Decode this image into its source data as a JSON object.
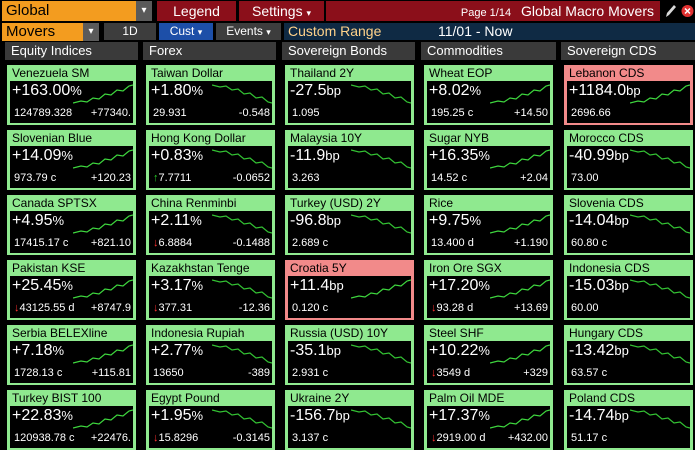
{
  "toolbar": {
    "view_select": "Global",
    "view_arrow": "▾",
    "legend_label": "Legend",
    "settings_label": "Settings",
    "settings_arrow": "▾",
    "page_label": "Page 1/14",
    "title": "Global Macro Movers"
  },
  "subbar": {
    "mode_select": "Movers",
    "period": "1D",
    "cust_label": "Cust",
    "cust_arrow": "▾",
    "events_label": "Events",
    "events_arrow": "▾",
    "range_label": "Custom Range",
    "range_value": "11/01 - Now"
  },
  "columns": [
    "Equity Indices",
    "Forex",
    "Sovereign Bonds",
    "Commodities",
    "Sovereign CDS"
  ],
  "colors": {
    "tile_up": "#8fe98f",
    "tile_down": "#f28a8a",
    "accent": "#f39c1f",
    "red_button": "#8b0f1a"
  },
  "tiles": [
    [
      {
        "name": "Venezuela SM",
        "pct": "+163.00",
        "unit": "%",
        "price": "124789.328",
        "chg": "+77340.",
        "arrow": "",
        "spark": "up"
      },
      {
        "name": "Slovenian Blue",
        "pct": "+14.09",
        "unit": "%",
        "price": "973.79 c",
        "chg": "+120.23",
        "arrow": "",
        "spark": "up"
      },
      {
        "name": "Canada SPTSX",
        "pct": "+4.95",
        "unit": "%",
        "price": "17415.17 c",
        "chg": "+821.10",
        "arrow": "",
        "spark": "up"
      },
      {
        "name": "Pakistan KSE",
        "pct": "+25.45",
        "unit": "%",
        "price": "43125.55 d",
        "chg": "+8747.9",
        "arrow": "down",
        "spark": "up"
      },
      {
        "name": "Serbia BELEXline",
        "pct": "+7.18",
        "unit": "%",
        "price": "1728.13 c",
        "chg": "+115.81",
        "arrow": "",
        "spark": "up"
      },
      {
        "name": "Turkey BIST 100",
        "pct": "+22.83",
        "unit": "%",
        "price": "120938.78 c",
        "chg": "+22476.",
        "arrow": "",
        "spark": "up"
      }
    ],
    [
      {
        "name": "Taiwan Dollar",
        "pct": "+1.80",
        "unit": "%",
        "price": "29.931",
        "chg": "-0.548",
        "arrow": "",
        "spark": "down"
      },
      {
        "name": "Hong Kong Dollar",
        "pct": "+0.83",
        "unit": "%",
        "price": "7.7711",
        "chg": "-0.0652",
        "arrow": "up",
        "spark": "down"
      },
      {
        "name": "China Renminbi",
        "pct": "+2.11",
        "unit": "%",
        "price": "6.8884",
        "chg": "-0.1488",
        "arrow": "down",
        "spark": "down"
      },
      {
        "name": "Kazakhstan Tenge",
        "pct": "+3.17",
        "unit": "%",
        "price": "377.31",
        "chg": "-12.36",
        "arrow": "down",
        "spark": "down"
      },
      {
        "name": "Indonesia Rupiah",
        "pct": "+2.77",
        "unit": "%",
        "price": "13650",
        "chg": "-389",
        "arrow": "",
        "spark": "down"
      },
      {
        "name": "Egypt Pound",
        "pct": "+1.95",
        "unit": "%",
        "price": "15.8296",
        "chg": "-0.3145",
        "arrow": "down",
        "spark": "down"
      }
    ],
    [
      {
        "name": "Thailand 2Y",
        "pct": "-27.5",
        "unit": "bp",
        "price": "1.095",
        "chg": "",
        "arrow": "",
        "spark": "down"
      },
      {
        "name": "Malaysia 10Y",
        "pct": "-11.9",
        "unit": "bp",
        "price": "3.263",
        "chg": "",
        "arrow": "",
        "spark": "down"
      },
      {
        "name": "Turkey (USD) 2Y",
        "pct": "-96.8",
        "unit": "bp",
        "price": "2.689 c",
        "chg": "",
        "arrow": "",
        "spark": "down"
      },
      {
        "name": "Croatia 5Y",
        "pct": "+11.4",
        "unit": "bp",
        "price": "0.120 c",
        "chg": "",
        "arrow": "",
        "spark": "up",
        "red": true
      },
      {
        "name": "Russia (USD) 10Y",
        "pct": "-35.1",
        "unit": "bp",
        "price": "2.931 c",
        "chg": "",
        "arrow": "",
        "spark": "down"
      },
      {
        "name": "Ukraine 2Y",
        "pct": "-156.7",
        "unit": "bp",
        "price": "3.137 c",
        "chg": "",
        "arrow": "",
        "spark": "down"
      }
    ],
    [
      {
        "name": "Wheat EOP",
        "pct": "+8.02",
        "unit": "%",
        "price": "195.25 c",
        "chg": "+14.50",
        "arrow": "",
        "spark": "up"
      },
      {
        "name": "Sugar NYB",
        "pct": "+16.35",
        "unit": "%",
        "price": "14.52 c",
        "chg": "+2.04",
        "arrow": "",
        "spark": "up"
      },
      {
        "name": "Rice",
        "pct": "+9.75",
        "unit": "%",
        "price": "13.400 d",
        "chg": "+1.190",
        "arrow": "",
        "spark": "up"
      },
      {
        "name": "Iron Ore SGX",
        "pct": "+17.20",
        "unit": "%",
        "price": "93.28 d",
        "chg": "+13.69",
        "arrow": "down",
        "spark": "up"
      },
      {
        "name": "Steel SHF",
        "pct": "+10.22",
        "unit": "%",
        "price": "3549 d",
        "chg": "+329",
        "arrow": "down",
        "spark": "up"
      },
      {
        "name": "Palm Oil MDE",
        "pct": "+17.37",
        "unit": "%",
        "price": "2919.00 d",
        "chg": "+432.00",
        "arrow": "down",
        "spark": "up"
      }
    ],
    [
      {
        "name": "Lebanon CDS",
        "pct": "+1184.0",
        "unit": "bp",
        "price": "2696.66",
        "chg": "",
        "arrow": "",
        "spark": "up",
        "red": true
      },
      {
        "name": "Morocco CDS",
        "pct": "-40.99",
        "unit": "bp",
        "price": "73.00",
        "chg": "",
        "arrow": "",
        "spark": "down"
      },
      {
        "name": "Slovenia CDS",
        "pct": "-14.04",
        "unit": "bp",
        "price": "60.80 c",
        "chg": "",
        "arrow": "",
        "spark": "down"
      },
      {
        "name": "Indonesia CDS",
        "pct": "-15.03",
        "unit": "bp",
        "price": "60.00",
        "chg": "",
        "arrow": "",
        "spark": "down"
      },
      {
        "name": "Hungary CDS",
        "pct": "-13.42",
        "unit": "bp",
        "price": "63.57 c",
        "chg": "",
        "arrow": "",
        "spark": "down"
      },
      {
        "name": "Poland CDS",
        "pct": "-14.74",
        "unit": "bp",
        "price": "51.17 c",
        "chg": "",
        "arrow": "",
        "spark": "down"
      }
    ]
  ]
}
